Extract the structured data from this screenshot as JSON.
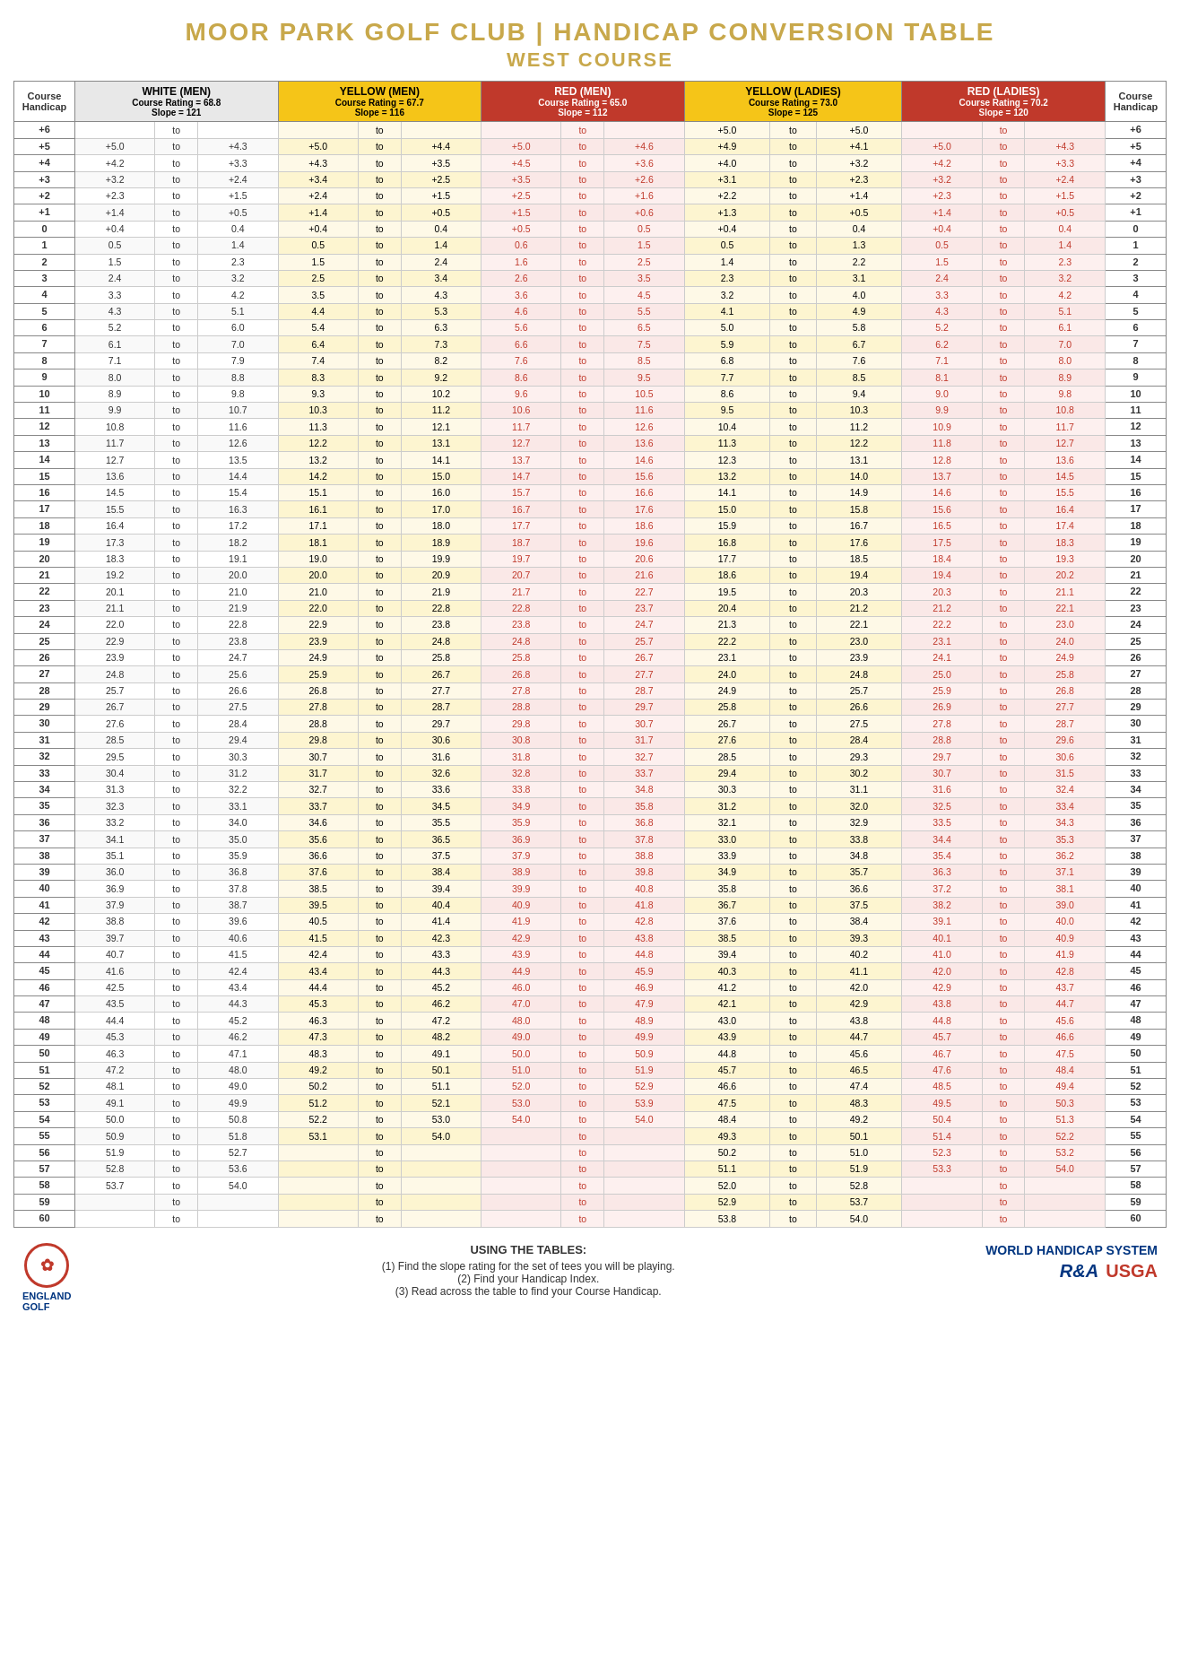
{
  "title": {
    "line1": "MOOR PARK GOLF CLUB | HANDICAP CONVERSION TABLE",
    "line2": "WEST COURSE"
  },
  "columns": {
    "courseHandicap": "Course\nHandicap",
    "white": {
      "title": "WHITE (MEN)",
      "rating": "Course Rating = 68.8",
      "slope": "Slope = 121"
    },
    "yellowMen": {
      "title": "YELLOW (MEN)",
      "rating": "Course Rating = 67.7",
      "slope": "Slope = 116"
    },
    "redMen": {
      "title": "RED (MEN)",
      "rating": "Course Rating = 65.0",
      "slope": "Slope = 112"
    },
    "yellowLadies": {
      "title": "YELLOW (LADIES)",
      "rating": "Course Rating = 73.0",
      "slope": "Slope = 125"
    },
    "redLadies": {
      "title": "RED (LADIES)",
      "rating": "Course Rating = 70.2",
      "slope": "Slope = 120"
    }
  },
  "footer": {
    "englandGolf": "ENGLAND\nGOLF",
    "usingTitle": "USING THE TABLES:",
    "steps": [
      "(1) Find the slope rating for the set of tees you will be playing.",
      "(2) Find your Handicap Index.",
      "(3) Read across the table to find your Course Handicap."
    ],
    "whs": "WORLD HANDICAP SYSTEM",
    "randa": "R&A",
    "usga": "USGA"
  },
  "rows": [
    {
      "ch": "+6",
      "w1": "",
      "w2": "",
      "ym1": "",
      "ym2": "",
      "rm1": "",
      "rm2": "",
      "yl1": "+5.0",
      "yl2": "+5.0",
      "rl1": "",
      "rl2": ""
    },
    {
      "ch": "+5",
      "w1": "+5.0",
      "w2": "+4.3",
      "ym1": "+5.0",
      "ym2": "+4.4",
      "rm1": "+5.0",
      "rm2": "+4.6",
      "yl1": "+4.9",
      "yl2": "+4.1",
      "rl1": "+5.0",
      "rl2": "+4.3"
    },
    {
      "ch": "+4",
      "w1": "+4.2",
      "w2": "+3.3",
      "ym1": "+4.3",
      "ym2": "+3.5",
      "rm1": "+4.5",
      "rm2": "+3.6",
      "yl1": "+4.0",
      "yl2": "+3.2",
      "rl1": "+4.2",
      "rl2": "+3.3"
    },
    {
      "ch": "+3",
      "w1": "+3.2",
      "w2": "+2.4",
      "ym1": "+3.4",
      "ym2": "+2.5",
      "rm1": "+3.5",
      "rm2": "+2.6",
      "yl1": "+3.1",
      "yl2": "+2.3",
      "rl1": "+3.2",
      "rl2": "+2.4"
    },
    {
      "ch": "+2",
      "w1": "+2.3",
      "w2": "+1.5",
      "ym1": "+2.4",
      "ym2": "+1.5",
      "rm1": "+2.5",
      "rm2": "+1.6",
      "yl1": "+2.2",
      "yl2": "+1.4",
      "rl1": "+2.3",
      "rl2": "+1.5"
    },
    {
      "ch": "+1",
      "w1": "+1.4",
      "w2": "+0.5",
      "ym1": "+1.4",
      "ym2": "+0.5",
      "rm1": "+1.5",
      "rm2": "+0.6",
      "yl1": "+1.3",
      "yl2": "+0.5",
      "rl1": "+1.4",
      "rl2": "+0.5"
    },
    {
      "ch": "0",
      "w1": "+0.4",
      "w2": "0.4",
      "ym1": "+0.4",
      "ym2": "0.4",
      "rm1": "+0.5",
      "rm2": "0.5",
      "yl1": "+0.4",
      "yl2": "0.4",
      "rl1": "+0.4",
      "rl2": "0.4"
    },
    {
      "ch": "1",
      "w1": "0.5",
      "w2": "1.4",
      "ym1": "0.5",
      "ym2": "1.4",
      "rm1": "0.6",
      "rm2": "1.5",
      "yl1": "0.5",
      "yl2": "1.3",
      "rl1": "0.5",
      "rl2": "1.4"
    },
    {
      "ch": "2",
      "w1": "1.5",
      "w2": "2.3",
      "ym1": "1.5",
      "ym2": "2.4",
      "rm1": "1.6",
      "rm2": "2.5",
      "yl1": "1.4",
      "yl2": "2.2",
      "rl1": "1.5",
      "rl2": "2.3"
    },
    {
      "ch": "3",
      "w1": "2.4",
      "w2": "3.2",
      "ym1": "2.5",
      "ym2": "3.4",
      "rm1": "2.6",
      "rm2": "3.5",
      "yl1": "2.3",
      "yl2": "3.1",
      "rl1": "2.4",
      "rl2": "3.2"
    },
    {
      "ch": "4",
      "w1": "3.3",
      "w2": "4.2",
      "ym1": "3.5",
      "ym2": "4.3",
      "rm1": "3.6",
      "rm2": "4.5",
      "yl1": "3.2",
      "yl2": "4.0",
      "rl1": "3.3",
      "rl2": "4.2"
    },
    {
      "ch": "5",
      "w1": "4.3",
      "w2": "5.1",
      "ym1": "4.4",
      "ym2": "5.3",
      "rm1": "4.6",
      "rm2": "5.5",
      "yl1": "4.1",
      "yl2": "4.9",
      "rl1": "4.3",
      "rl2": "5.1"
    },
    {
      "ch": "6",
      "w1": "5.2",
      "w2": "6.0",
      "ym1": "5.4",
      "ym2": "6.3",
      "rm1": "5.6",
      "rm2": "6.5",
      "yl1": "5.0",
      "yl2": "5.8",
      "rl1": "5.2",
      "rl2": "6.1"
    },
    {
      "ch": "7",
      "w1": "6.1",
      "w2": "7.0",
      "ym1": "6.4",
      "ym2": "7.3",
      "rm1": "6.6",
      "rm2": "7.5",
      "yl1": "5.9",
      "yl2": "6.7",
      "rl1": "6.2",
      "rl2": "7.0"
    },
    {
      "ch": "8",
      "w1": "7.1",
      "w2": "7.9",
      "ym1": "7.4",
      "ym2": "8.2",
      "rm1": "7.6",
      "rm2": "8.5",
      "yl1": "6.8",
      "yl2": "7.6",
      "rl1": "7.1",
      "rl2": "8.0"
    },
    {
      "ch": "9",
      "w1": "8.0",
      "w2": "8.8",
      "ym1": "8.3",
      "ym2": "9.2",
      "rm1": "8.6",
      "rm2": "9.5",
      "yl1": "7.7",
      "yl2": "8.5",
      "rl1": "8.1",
      "rl2": "8.9"
    },
    {
      "ch": "10",
      "w1": "8.9",
      "w2": "9.8",
      "ym1": "9.3",
      "ym2": "10.2",
      "rm1": "9.6",
      "rm2": "10.5",
      "yl1": "8.6",
      "yl2": "9.4",
      "rl1": "9.0",
      "rl2": "9.8"
    },
    {
      "ch": "11",
      "w1": "9.9",
      "w2": "10.7",
      "ym1": "10.3",
      "ym2": "11.2",
      "rm1": "10.6",
      "rm2": "11.6",
      "yl1": "9.5",
      "yl2": "10.3",
      "rl1": "9.9",
      "rl2": "10.8"
    },
    {
      "ch": "12",
      "w1": "10.8",
      "w2": "11.6",
      "ym1": "11.3",
      "ym2": "12.1",
      "rm1": "11.7",
      "rm2": "12.6",
      "yl1": "10.4",
      "yl2": "11.2",
      "rl1": "10.9",
      "rl2": "11.7"
    },
    {
      "ch": "13",
      "w1": "11.7",
      "w2": "12.6",
      "ym1": "12.2",
      "ym2": "13.1",
      "rm1": "12.7",
      "rm2": "13.6",
      "yl1": "11.3",
      "yl2": "12.2",
      "rl1": "11.8",
      "rl2": "12.7"
    },
    {
      "ch": "14",
      "w1": "12.7",
      "w2": "13.5",
      "ym1": "13.2",
      "ym2": "14.1",
      "rm1": "13.7",
      "rm2": "14.6",
      "yl1": "12.3",
      "yl2": "13.1",
      "rl1": "12.8",
      "rl2": "13.6"
    },
    {
      "ch": "15",
      "w1": "13.6",
      "w2": "14.4",
      "ym1": "14.2",
      "ym2": "15.0",
      "rm1": "14.7",
      "rm2": "15.6",
      "yl1": "13.2",
      "yl2": "14.0",
      "rl1": "13.7",
      "rl2": "14.5"
    },
    {
      "ch": "16",
      "w1": "14.5",
      "w2": "15.4",
      "ym1": "15.1",
      "ym2": "16.0",
      "rm1": "15.7",
      "rm2": "16.6",
      "yl1": "14.1",
      "yl2": "14.9",
      "rl1": "14.6",
      "rl2": "15.5"
    },
    {
      "ch": "17",
      "w1": "15.5",
      "w2": "16.3",
      "ym1": "16.1",
      "ym2": "17.0",
      "rm1": "16.7",
      "rm2": "17.6",
      "yl1": "15.0",
      "yl2": "15.8",
      "rl1": "15.6",
      "rl2": "16.4"
    },
    {
      "ch": "18",
      "w1": "16.4",
      "w2": "17.2",
      "ym1": "17.1",
      "ym2": "18.0",
      "rm1": "17.7",
      "rm2": "18.6",
      "yl1": "15.9",
      "yl2": "16.7",
      "rl1": "16.5",
      "rl2": "17.4"
    },
    {
      "ch": "19",
      "w1": "17.3",
      "w2": "18.2",
      "ym1": "18.1",
      "ym2": "18.9",
      "rm1": "18.7",
      "rm2": "19.6",
      "yl1": "16.8",
      "yl2": "17.6",
      "rl1": "17.5",
      "rl2": "18.3"
    },
    {
      "ch": "20",
      "w1": "18.3",
      "w2": "19.1",
      "ym1": "19.0",
      "ym2": "19.9",
      "rm1": "19.7",
      "rm2": "20.6",
      "yl1": "17.7",
      "yl2": "18.5",
      "rl1": "18.4",
      "rl2": "19.3"
    },
    {
      "ch": "21",
      "w1": "19.2",
      "w2": "20.0",
      "ym1": "20.0",
      "ym2": "20.9",
      "rm1": "20.7",
      "rm2": "21.6",
      "yl1": "18.6",
      "yl2": "19.4",
      "rl1": "19.4",
      "rl2": "20.2"
    },
    {
      "ch": "22",
      "w1": "20.1",
      "w2": "21.0",
      "ym1": "21.0",
      "ym2": "21.9",
      "rm1": "21.7",
      "rm2": "22.7",
      "yl1": "19.5",
      "yl2": "20.3",
      "rl1": "20.3",
      "rl2": "21.1"
    },
    {
      "ch": "23",
      "w1": "21.1",
      "w2": "21.9",
      "ym1": "22.0",
      "ym2": "22.8",
      "rm1": "22.8",
      "rm2": "23.7",
      "yl1": "20.4",
      "yl2": "21.2",
      "rl1": "21.2",
      "rl2": "22.1"
    },
    {
      "ch": "24",
      "w1": "22.0",
      "w2": "22.8",
      "ym1": "22.9",
      "ym2": "23.8",
      "rm1": "23.8",
      "rm2": "24.7",
      "yl1": "21.3",
      "yl2": "22.1",
      "rl1": "22.2",
      "rl2": "23.0"
    },
    {
      "ch": "25",
      "w1": "22.9",
      "w2": "23.8",
      "ym1": "23.9",
      "ym2": "24.8",
      "rm1": "24.8",
      "rm2": "25.7",
      "yl1": "22.2",
      "yl2": "23.0",
      "rl1": "23.1",
      "rl2": "24.0"
    },
    {
      "ch": "26",
      "w1": "23.9",
      "w2": "24.7",
      "ym1": "24.9",
      "ym2": "25.8",
      "rm1": "25.8",
      "rm2": "26.7",
      "yl1": "23.1",
      "yl2": "23.9",
      "rl1": "24.1",
      "rl2": "24.9"
    },
    {
      "ch": "27",
      "w1": "24.8",
      "w2": "25.6",
      "ym1": "25.9",
      "ym2": "26.7",
      "rm1": "26.8",
      "rm2": "27.7",
      "yl1": "24.0",
      "yl2": "24.8",
      "rl1": "25.0",
      "rl2": "25.8"
    },
    {
      "ch": "28",
      "w1": "25.7",
      "w2": "26.6",
      "ym1": "26.8",
      "ym2": "27.7",
      "rm1": "27.8",
      "rm2": "28.7",
      "yl1": "24.9",
      "yl2": "25.7",
      "rl1": "25.9",
      "rl2": "26.8"
    },
    {
      "ch": "29",
      "w1": "26.7",
      "w2": "27.5",
      "ym1": "27.8",
      "ym2": "28.7",
      "rm1": "28.8",
      "rm2": "29.7",
      "yl1": "25.8",
      "yl2": "26.6",
      "rl1": "26.9",
      "rl2": "27.7"
    },
    {
      "ch": "30",
      "w1": "27.6",
      "w2": "28.4",
      "ym1": "28.8",
      "ym2": "29.7",
      "rm1": "29.8",
      "rm2": "30.7",
      "yl1": "26.7",
      "yl2": "27.5",
      "rl1": "27.8",
      "rl2": "28.7"
    },
    {
      "ch": "31",
      "w1": "28.5",
      "w2": "29.4",
      "ym1": "29.8",
      "ym2": "30.6",
      "rm1": "30.8",
      "rm2": "31.7",
      "yl1": "27.6",
      "yl2": "28.4",
      "rl1": "28.8",
      "rl2": "29.6"
    },
    {
      "ch": "32",
      "w1": "29.5",
      "w2": "30.3",
      "ym1": "30.7",
      "ym2": "31.6",
      "rm1": "31.8",
      "rm2": "32.7",
      "yl1": "28.5",
      "yl2": "29.3",
      "rl1": "29.7",
      "rl2": "30.6"
    },
    {
      "ch": "33",
      "w1": "30.4",
      "w2": "31.2",
      "ym1": "31.7",
      "ym2": "32.6",
      "rm1": "32.8",
      "rm2": "33.7",
      "yl1": "29.4",
      "yl2": "30.2",
      "rl1": "30.7",
      "rl2": "31.5"
    },
    {
      "ch": "34",
      "w1": "31.3",
      "w2": "32.2",
      "ym1": "32.7",
      "ym2": "33.6",
      "rm1": "33.8",
      "rm2": "34.8",
      "yl1": "30.3",
      "yl2": "31.1",
      "rl1": "31.6",
      "rl2": "32.4"
    },
    {
      "ch": "35",
      "w1": "32.3",
      "w2": "33.1",
      "ym1": "33.7",
      "ym2": "34.5",
      "rm1": "34.9",
      "rm2": "35.8",
      "yl1": "31.2",
      "yl2": "32.0",
      "rl1": "32.5",
      "rl2": "33.4"
    },
    {
      "ch": "36",
      "w1": "33.2",
      "w2": "34.0",
      "ym1": "34.6",
      "ym2": "35.5",
      "rm1": "35.9",
      "rm2": "36.8",
      "yl1": "32.1",
      "yl2": "32.9",
      "rl1": "33.5",
      "rl2": "34.3"
    },
    {
      "ch": "37",
      "w1": "34.1",
      "w2": "35.0",
      "ym1": "35.6",
      "ym2": "36.5",
      "rm1": "36.9",
      "rm2": "37.8",
      "yl1": "33.0",
      "yl2": "33.8",
      "rl1": "34.4",
      "rl2": "35.3"
    },
    {
      "ch": "38",
      "w1": "35.1",
      "w2": "35.9",
      "ym1": "36.6",
      "ym2": "37.5",
      "rm1": "37.9",
      "rm2": "38.8",
      "yl1": "33.9",
      "yl2": "34.8",
      "rl1": "35.4",
      "rl2": "36.2"
    },
    {
      "ch": "39",
      "w1": "36.0",
      "w2": "36.8",
      "ym1": "37.6",
      "ym2": "38.4",
      "rm1": "38.9",
      "rm2": "39.8",
      "yl1": "34.9",
      "yl2": "35.7",
      "rl1": "36.3",
      "rl2": "37.1"
    },
    {
      "ch": "40",
      "w1": "36.9",
      "w2": "37.8",
      "ym1": "38.5",
      "ym2": "39.4",
      "rm1": "39.9",
      "rm2": "40.8",
      "yl1": "35.8",
      "yl2": "36.6",
      "rl1": "37.2",
      "rl2": "38.1"
    },
    {
      "ch": "41",
      "w1": "37.9",
      "w2": "38.7",
      "ym1": "39.5",
      "ym2": "40.4",
      "rm1": "40.9",
      "rm2": "41.8",
      "yl1": "36.7",
      "yl2": "37.5",
      "rl1": "38.2",
      "rl2": "39.0"
    },
    {
      "ch": "42",
      "w1": "38.8",
      "w2": "39.6",
      "ym1": "40.5",
      "ym2": "41.4",
      "rm1": "41.9",
      "rm2": "42.8",
      "yl1": "37.6",
      "yl2": "38.4",
      "rl1": "39.1",
      "rl2": "40.0"
    },
    {
      "ch": "43",
      "w1": "39.7",
      "w2": "40.6",
      "ym1": "41.5",
      "ym2": "42.3",
      "rm1": "42.9",
      "rm2": "43.8",
      "yl1": "38.5",
      "yl2": "39.3",
      "rl1": "40.1",
      "rl2": "40.9"
    },
    {
      "ch": "44",
      "w1": "40.7",
      "w2": "41.5",
      "ym1": "42.4",
      "ym2": "43.3",
      "rm1": "43.9",
      "rm2": "44.8",
      "yl1": "39.4",
      "yl2": "40.2",
      "rl1": "41.0",
      "rl2": "41.9"
    },
    {
      "ch": "45",
      "w1": "41.6",
      "w2": "42.4",
      "ym1": "43.4",
      "ym2": "44.3",
      "rm1": "44.9",
      "rm2": "45.9",
      "yl1": "40.3",
      "yl2": "41.1",
      "rl1": "42.0",
      "rl2": "42.8"
    },
    {
      "ch": "46",
      "w1": "42.5",
      "w2": "43.4",
      "ym1": "44.4",
      "ym2": "45.2",
      "rm1": "46.0",
      "rm2": "46.9",
      "yl1": "41.2",
      "yl2": "42.0",
      "rl1": "42.9",
      "rl2": "43.7"
    },
    {
      "ch": "47",
      "w1": "43.5",
      "w2": "44.3",
      "ym1": "45.3",
      "ym2": "46.2",
      "rm1": "47.0",
      "rm2": "47.9",
      "yl1": "42.1",
      "yl2": "42.9",
      "rl1": "43.8",
      "rl2": "44.7"
    },
    {
      "ch": "48",
      "w1": "44.4",
      "w2": "45.2",
      "ym1": "46.3",
      "ym2": "47.2",
      "rm1": "48.0",
      "rm2": "48.9",
      "yl1": "43.0",
      "yl2": "43.8",
      "rl1": "44.8",
      "rl2": "45.6"
    },
    {
      "ch": "49",
      "w1": "45.3",
      "w2": "46.2",
      "ym1": "47.3",
      "ym2": "48.2",
      "rm1": "49.0",
      "rm2": "49.9",
      "yl1": "43.9",
      "yl2": "44.7",
      "rl1": "45.7",
      "rl2": "46.6"
    },
    {
      "ch": "50",
      "w1": "46.3",
      "w2": "47.1",
      "ym1": "48.3",
      "ym2": "49.1",
      "rm1": "50.0",
      "rm2": "50.9",
      "yl1": "44.8",
      "yl2": "45.6",
      "rl1": "46.7",
      "rl2": "47.5"
    },
    {
      "ch": "51",
      "w1": "47.2",
      "w2": "48.0",
      "ym1": "49.2",
      "ym2": "50.1",
      "rm1": "51.0",
      "rm2": "51.9",
      "yl1": "45.7",
      "yl2": "46.5",
      "rl1": "47.6",
      "rl2": "48.4"
    },
    {
      "ch": "52",
      "w1": "48.1",
      "w2": "49.0",
      "ym1": "50.2",
      "ym2": "51.1",
      "rm1": "52.0",
      "rm2": "52.9",
      "yl1": "46.6",
      "yl2": "47.4",
      "rl1": "48.5",
      "rl2": "49.4"
    },
    {
      "ch": "53",
      "w1": "49.1",
      "w2": "49.9",
      "ym1": "51.2",
      "ym2": "52.1",
      "rm1": "53.0",
      "rm2": "53.9",
      "yl1": "47.5",
      "yl2": "48.3",
      "rl1": "49.5",
      "rl2": "50.3"
    },
    {
      "ch": "54",
      "w1": "50.0",
      "w2": "50.8",
      "ym1": "52.2",
      "ym2": "53.0",
      "rm1": "54.0",
      "rm2": "54.0",
      "yl1": "48.4",
      "yl2": "49.2",
      "rl1": "50.4",
      "rl2": "51.3"
    },
    {
      "ch": "55",
      "w1": "50.9",
      "w2": "51.8",
      "ym1": "53.1",
      "ym2": "54.0",
      "rm1": "",
      "rm2": "",
      "yl1": "49.3",
      "yl2": "50.1",
      "rl1": "51.4",
      "rl2": "52.2"
    },
    {
      "ch": "56",
      "w1": "51.9",
      "w2": "52.7",
      "ym1": "",
      "ym2": "",
      "rm1": "",
      "rm2": "",
      "yl1": "50.2",
      "yl2": "51.0",
      "rl1": "52.3",
      "rl2": "53.2"
    },
    {
      "ch": "57",
      "w1": "52.8",
      "w2": "53.6",
      "ym1": "",
      "ym2": "",
      "rm1": "",
      "rm2": "",
      "yl1": "51.1",
      "yl2": "51.9",
      "rl1": "53.3",
      "rl2": "54.0"
    },
    {
      "ch": "58",
      "w1": "53.7",
      "w2": "54.0",
      "ym1": "",
      "ym2": "",
      "rm1": "",
      "rm2": "",
      "yl1": "52.0",
      "yl2": "52.8",
      "rl1": "",
      "rl2": ""
    },
    {
      "ch": "59",
      "w1": "",
      "w2": "",
      "ym1": "",
      "ym2": "",
      "rm1": "",
      "rm2": "",
      "yl1": "52.9",
      "yl2": "53.7",
      "rl1": "",
      "rl2": ""
    },
    {
      "ch": "60",
      "w1": "",
      "w2": "",
      "ym1": "",
      "ym2": "",
      "rm1": "",
      "rm2": "",
      "yl1": "53.8",
      "yl2": "54.0",
      "rl1": "",
      "rl2": ""
    }
  ]
}
